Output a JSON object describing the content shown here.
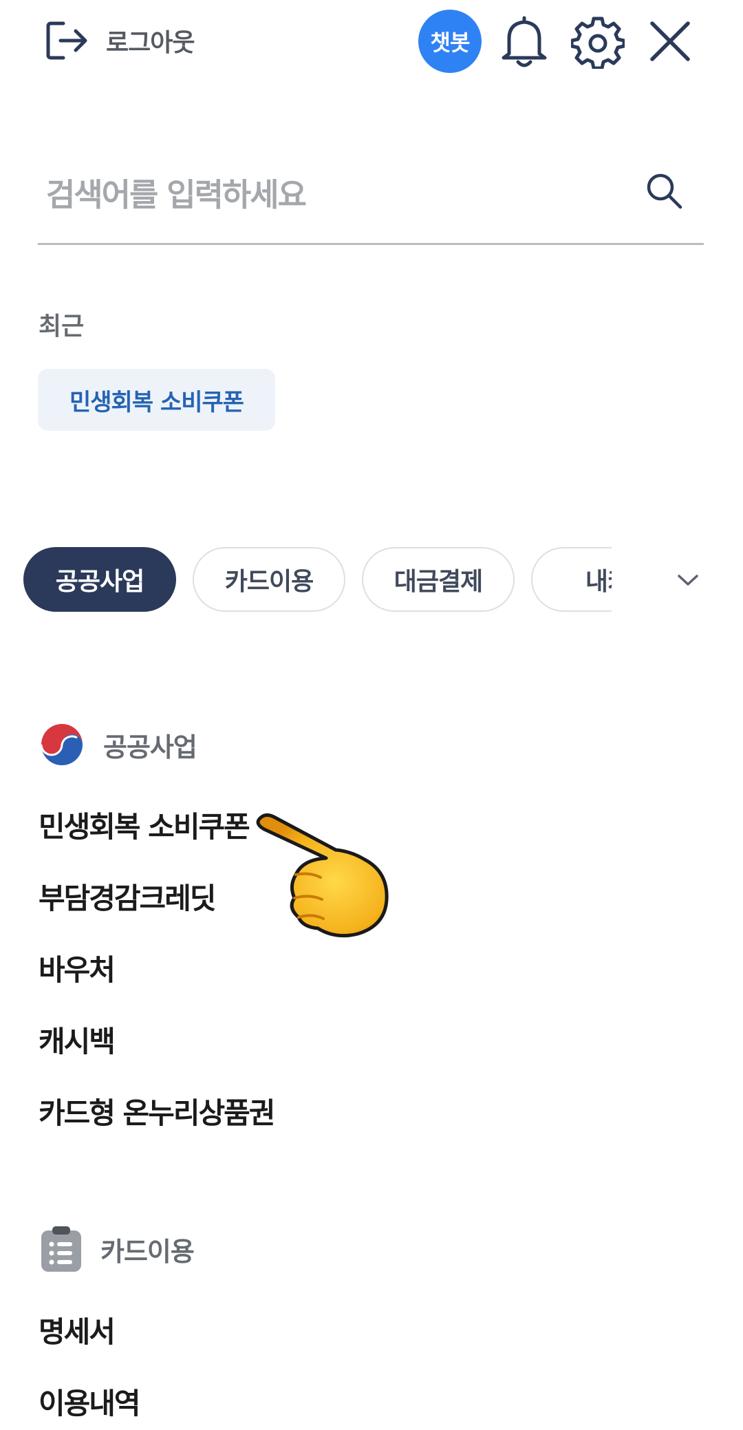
{
  "header": {
    "logout_label": "로그아웃",
    "chatbot_label": "챗봇",
    "icons": [
      "logout-icon",
      "bell-icon",
      "gear-icon",
      "close-icon"
    ]
  },
  "search": {
    "placeholder": "검색어를 입력하세요",
    "value": ""
  },
  "recent": {
    "title": "최근",
    "items": [
      "민생회복 소비쿠폰"
    ]
  },
  "tabs": {
    "items": [
      "공공사업",
      "카드이용",
      "대금결제",
      "내카"
    ],
    "active_index": 0
  },
  "sections": [
    {
      "title": "공공사업",
      "icon": "government-emblem-icon",
      "items": [
        "민생회복 소비쿠폰",
        "부담경감크레딧",
        "바우처",
        "캐시백",
        "카드형 온누리상품권"
      ]
    },
    {
      "title": "카드이용",
      "icon": "clipboard-list-icon",
      "items": [
        "명세서",
        "이용내역"
      ]
    }
  ],
  "colors": {
    "accent_blue": "#2f82f3",
    "active_tab": "#2b3a5a",
    "chip_bg": "#eef3f9",
    "chip_text": "#2563b3"
  }
}
